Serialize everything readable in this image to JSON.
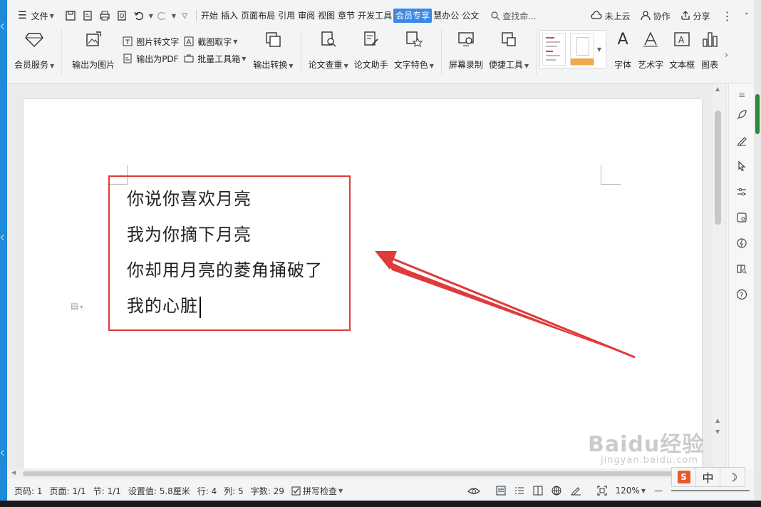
{
  "menu": {
    "file_label": "文件",
    "tabs": [
      "开始",
      "插入",
      "页面布局",
      "引用",
      "审阅",
      "视图",
      "章节",
      "开发工具",
      "会员专享",
      "慧办公",
      "公文"
    ],
    "active_tab_index": 8,
    "search_label": "查找命...",
    "cloud_label": "未上云",
    "collab_label": "协作",
    "share_label": "分享"
  },
  "ribbon": {
    "vip_service": "会员服务",
    "export_image": "输出为图片",
    "img_to_text": "图片转文字",
    "export_pdf": "输出为PDF",
    "screenshot_ocr": "截图取字",
    "batch_tools": "批量工具箱",
    "export_convert": "输出转换",
    "thesis_check": "论文查重",
    "thesis_helper": "论文助手",
    "text_feature": "文字特色",
    "screen_record": "屏幕录制",
    "quick_tools": "便捷工具",
    "font": "字体",
    "art_text": "艺术字",
    "text_box": "文本框",
    "chart": "图表"
  },
  "document": {
    "lines": [
      "你说你喜欢月亮",
      "我为你摘下月亮",
      "你却用月亮的菱角捅破了",
      "我的心脏"
    ]
  },
  "colors": {
    "accent": "#3c88e6",
    "annotation_red": "#e03a3a",
    "page": "#ffffff"
  },
  "status": {
    "page_code": "页码: 1",
    "pages": "页面: 1/1",
    "section": "节: 1/1",
    "setting": "设置值: 5.8厘米",
    "row": "行: 4",
    "col": "列: 5",
    "word_count": "字数: 29",
    "spell_check": "拼写检查",
    "zoom": "120%"
  },
  "ime": {
    "logo": "S",
    "mode": "中",
    "moon": "☽"
  },
  "watermark": {
    "main": "Baidu经验",
    "sub": "jingyan.baidu.com"
  }
}
